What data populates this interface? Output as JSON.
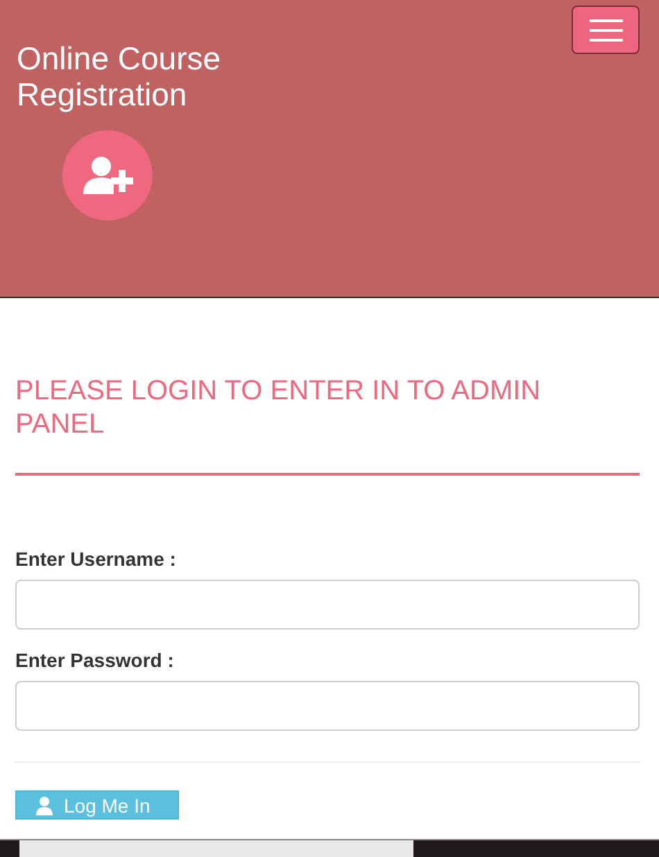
{
  "header": {
    "title": "Online Course Registration"
  },
  "login": {
    "heading": "PLEASE LOGIN TO ENTER IN TO ADMIN PANEL",
    "fields": [
      {
        "label": "Enter Username :"
      },
      {
        "label": "Enter Password :"
      }
    ],
    "button": "Log Me In"
  }
}
